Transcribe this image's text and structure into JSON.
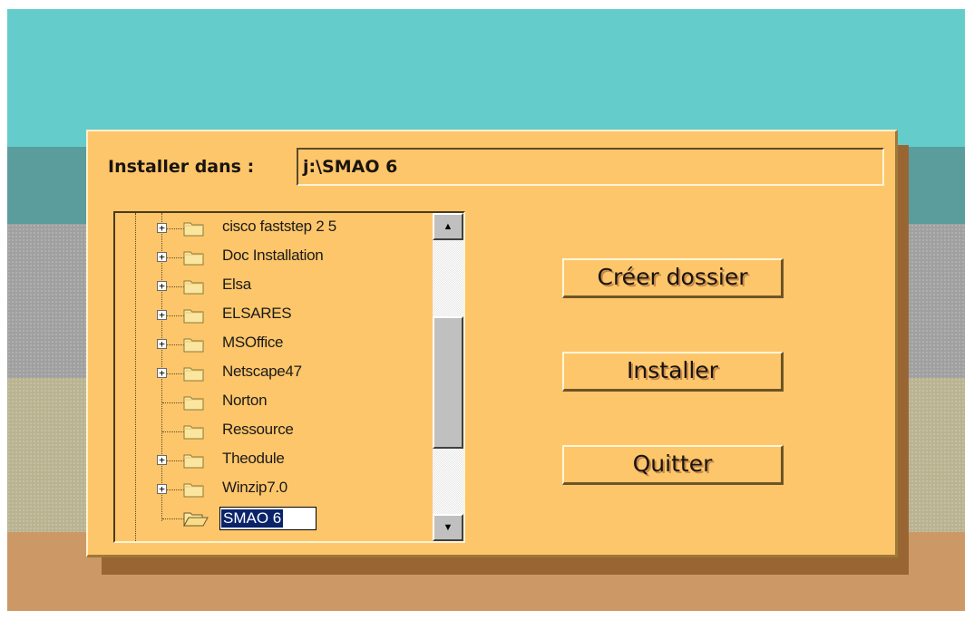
{
  "dialog": {
    "path_label": "Installer dans :",
    "path_value": "j:\\SMAO 6"
  },
  "tree": {
    "items": [
      {
        "label": "cisco faststep 2 5",
        "expandable": true
      },
      {
        "label": "Doc Installation",
        "expandable": true
      },
      {
        "label": "Elsa",
        "expandable": true
      },
      {
        "label": "ELSARES",
        "expandable": true
      },
      {
        "label": "MSOffice",
        "expandable": true
      },
      {
        "label": "Netscape47",
        "expandable": true
      },
      {
        "label": "Norton",
        "expandable": false
      },
      {
        "label": "Ressource",
        "expandable": false
      },
      {
        "label": "Theodule",
        "expandable": true
      },
      {
        "label": "Winzip7.0",
        "expandable": true
      }
    ],
    "new_folder": {
      "label": "SMAO 6",
      "state": "editing"
    },
    "scroll_up_icon": "arrow-up",
    "scroll_down_icon": "arrow-down",
    "expander_symbol": "+"
  },
  "buttons": {
    "create_label": "Créer dossier",
    "install_label": "Installer",
    "quit_label": "Quitter"
  },
  "colors": {
    "dialog_bg": "#fec66a",
    "desktop_teal": "#65cccc",
    "selection": "#0a246a"
  }
}
